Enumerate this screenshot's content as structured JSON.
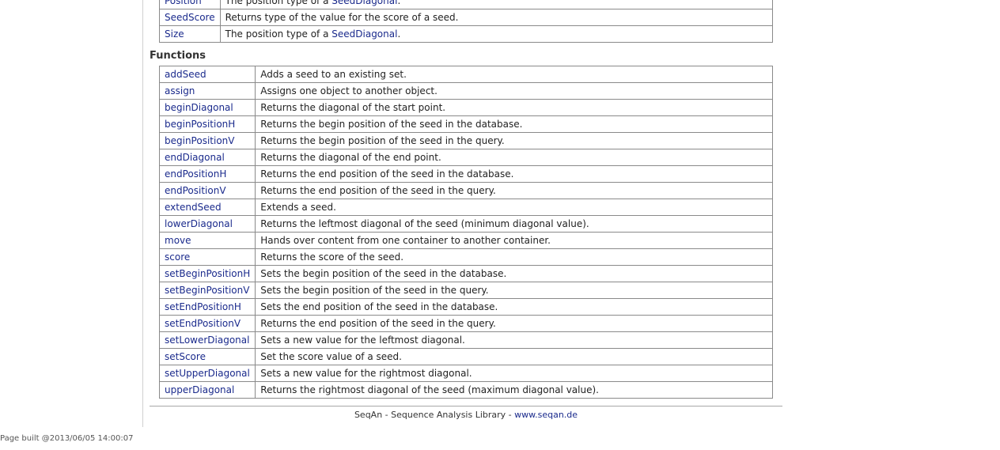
{
  "types": [
    {
      "name": "Position",
      "desc_prefix": "The position type of a ",
      "desc_link": "SeedDiagonal",
      "desc_suffix": "."
    },
    {
      "name": "SeedScore",
      "desc_prefix": "Returns type of the value for the score of a seed.",
      "desc_link": "",
      "desc_suffix": ""
    },
    {
      "name": "Size",
      "desc_prefix": "The position type of a ",
      "desc_link": "SeedDiagonal",
      "desc_suffix": "."
    }
  ],
  "functions_title": "Functions",
  "functions": [
    {
      "name": "addSeed",
      "desc": "Adds a seed to an existing set."
    },
    {
      "name": "assign",
      "desc": "Assigns one object to another object."
    },
    {
      "name": "beginDiagonal",
      "desc": "Returns the diagonal of the start point."
    },
    {
      "name": "beginPositionH",
      "desc": "Returns the begin position of the seed in the database."
    },
    {
      "name": "beginPositionV",
      "desc": "Returns the begin position of the seed in the query."
    },
    {
      "name": "endDiagonal",
      "desc": "Returns the diagonal of the end point."
    },
    {
      "name": "endPositionH",
      "desc": "Returns the end position of the seed in the database."
    },
    {
      "name": "endPositionV",
      "desc": "Returns the end position of the seed in the query."
    },
    {
      "name": "extendSeed",
      "desc": "Extends a seed."
    },
    {
      "name": "lowerDiagonal",
      "desc": "Returns the leftmost diagonal of the seed (minimum diagonal value)."
    },
    {
      "name": "move",
      "desc": "Hands over content from one container to another container."
    },
    {
      "name": "score",
      "desc": "Returns the score of the seed."
    },
    {
      "name": "setBeginPositionH",
      "desc": "Sets the begin position of the seed in the database."
    },
    {
      "name": "setBeginPositionV",
      "desc": "Sets the begin position of the seed in the query."
    },
    {
      "name": "setEndPositionH",
      "desc": "Sets the end position of the seed in the database."
    },
    {
      "name": "setEndPositionV",
      "desc": "Returns the end position of the seed in the query."
    },
    {
      "name": "setLowerDiagonal",
      "desc": "Sets a new value for the leftmost diagonal."
    },
    {
      "name": "setScore",
      "desc": "Set the score value of a seed."
    },
    {
      "name": "setUpperDiagonal",
      "desc": "Sets a new value for the rightmost diagonal."
    },
    {
      "name": "upperDiagonal",
      "desc": "Returns the rightmost diagonal of the seed (maximum diagonal value)."
    }
  ],
  "footer": {
    "text": "SeqAn - Sequence Analysis Library - ",
    "link": "www.seqan.de"
  },
  "built": "Page built @2013/06/05 14:00:07",
  "colors": {
    "link": "#1a2a8c",
    "border": "#8a8a8a",
    "rule": "#d0d0d0"
  }
}
